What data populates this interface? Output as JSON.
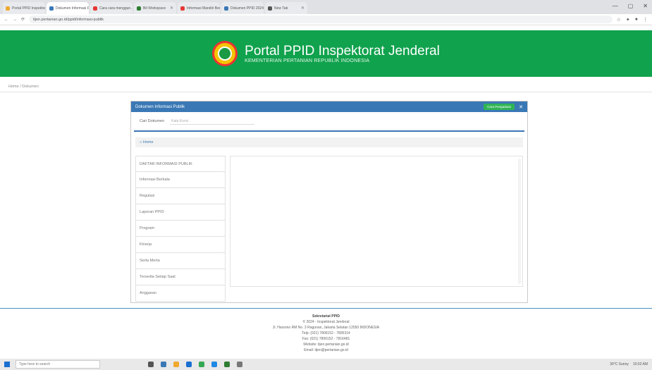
{
  "browser": {
    "tabs": [
      {
        "label": "Portal PPID Inspektorat Jenderal ...",
        "color": "#f0a92f",
        "active": false
      },
      {
        "label": "Dokumen Informasi Publik",
        "color": "#3a78b5",
        "active": true
      },
      {
        "label": "Cara cara menggun...",
        "color": "#e53935",
        "active": false
      },
      {
        "label": "Bit Workspace",
        "color": "#2e7d32",
        "active": false
      },
      {
        "label": "Informasi Mandiri Berkas...",
        "color": "#e53935",
        "active": false
      },
      {
        "label": "Dokumen PPID 2024 ...",
        "color": "#3a78b5",
        "active": false
      },
      {
        "label": "New Tab",
        "color": "#555555",
        "active": false
      }
    ],
    "url": "itjen.pertanian.go.id/ppid/informasi-publik"
  },
  "header": {
    "title": "Portal PPID Inspektorat Jenderal",
    "subtitle": "KEMENTERIAN PERTANIAN REPUBLIK INDONESIA"
  },
  "breadcrumb": "Home / Dokumen",
  "panel": {
    "title": "Dokumen Informasi Publik",
    "button": "Cara Pengaduan",
    "search_label": "Cari Dokumen",
    "search_placeholder": "Kata Kunci",
    "path": "Home"
  },
  "categories": [
    "DAFTAR INFORMASI PUBLIK",
    "Informasi Berkala",
    "Regulasi",
    "Laporan PPID",
    "Program",
    "Kinerja",
    "Serta Merta",
    "Tersedia Setiap Saat",
    "Anggaran"
  ],
  "footer": {
    "title": "Sekretariat PPID",
    "lines": [
      "© 2024 - Inspektorat Jenderal",
      "Jl. Harsono RM No. 3 Ragunan, Jakarta Selatan 12550 INDONESIA",
      "Telp: (021) 7806152 - 7805314",
      "Fax: (021) 7806152 - 7816481",
      "Website: itjen.pertanian.go.id",
      "Email: itjen@pertanian.go.id"
    ]
  },
  "taskbar": {
    "search_placeholder": "Type here to search",
    "weather": "30°C Sunny",
    "time": "10:02 AM"
  }
}
